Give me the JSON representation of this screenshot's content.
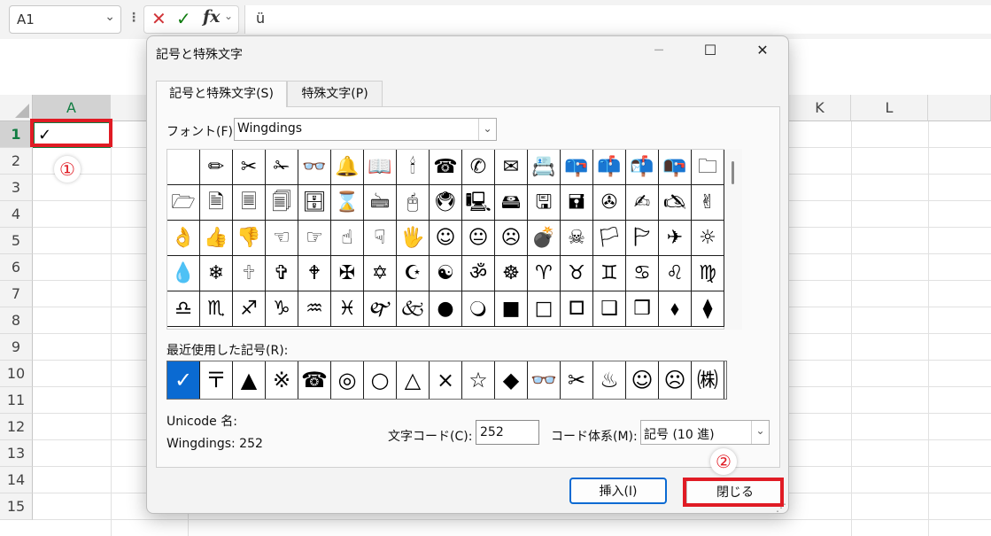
{
  "excel": {
    "name_box": "A1",
    "name_box_arrow": "⌄",
    "fx_separator": "⋮",
    "cancel_glyph": "✕",
    "enter_glyph": "✓",
    "fx_label": "fx",
    "fx_drop": "⌄",
    "formula_value": "ü",
    "columns": [
      "A",
      "K",
      "L"
    ],
    "rows": [
      "1",
      "2",
      "3",
      "4",
      "5",
      "6",
      "7",
      "8",
      "9",
      "10",
      "11",
      "12",
      "13",
      "14",
      "15"
    ],
    "cell_a1": "✓",
    "annotation_1": "①",
    "annotation_2": "②",
    "accent_color": "#107c41",
    "highlight_color": "#e01b24"
  },
  "dialog": {
    "title": "記号と特殊文字",
    "minimize_glyph": "─",
    "maximize_glyph": "☐",
    "close_glyph": "✕",
    "tabs": [
      "記号と特殊文字(S)",
      "特殊文字(P)"
    ],
    "font_label": "フォント(F):",
    "font_value": "Wingdings",
    "combo_arrow": "⌄",
    "symbols": [
      "",
      "✏",
      "✂",
      "✁",
      "👓",
      "🔔",
      "📖",
      "🕯",
      "☎",
      "✆",
      "✉",
      "📇",
      "📪",
      "📫",
      "📬",
      "📭",
      "🗀",
      "🗁",
      "🗎",
      "🗏",
      "🗐",
      "🗄",
      "⌛",
      "🖮",
      "🖰",
      "🖲",
      "🖳",
      "🖴",
      "🖫",
      "🖬",
      "✇",
      "✍",
      "🖎",
      "✌",
      "👌",
      "👍",
      "👎",
      "☜",
      "☞",
      "☝",
      "☟",
      "🖐",
      "☺",
      "😐",
      "☹",
      "💣",
      "☠",
      "🏳",
      "🏱",
      "✈",
      "☼",
      "💧",
      "❄",
      "🕆",
      "✞",
      "🕈",
      "✠",
      "✡",
      "☪",
      "☯",
      "ॐ",
      "☸",
      "♈",
      "♉",
      "♊",
      "♋",
      "♌",
      "♍",
      "♎",
      "♏",
      "♐",
      "♑",
      "♒",
      "♓",
      "🙰",
      "🙵",
      "●",
      "🔾",
      "■",
      "□",
      "🞐",
      "❑",
      "❒",
      "⬧",
      "⧫"
    ],
    "recent_label": "最近使用した記号(R):",
    "recent": [
      "✓",
      "〒",
      "▲",
      "※",
      "☎",
      "◎",
      "○",
      "△",
      "×",
      "☆",
      "◆",
      "👓",
      "✂",
      "♨",
      "☺",
      "☹",
      "㈱"
    ],
    "unicode_name_label": "Unicode 名:",
    "char_name": "Wingdings: 252",
    "char_code_label": "文字コード(C):",
    "char_code_value": "252",
    "code_system_label": "コード体系(M):",
    "code_system_value": "記号 (10 進)",
    "insert_button": "挿入(I)",
    "close_button": "閉じる",
    "grip": "⋰"
  }
}
